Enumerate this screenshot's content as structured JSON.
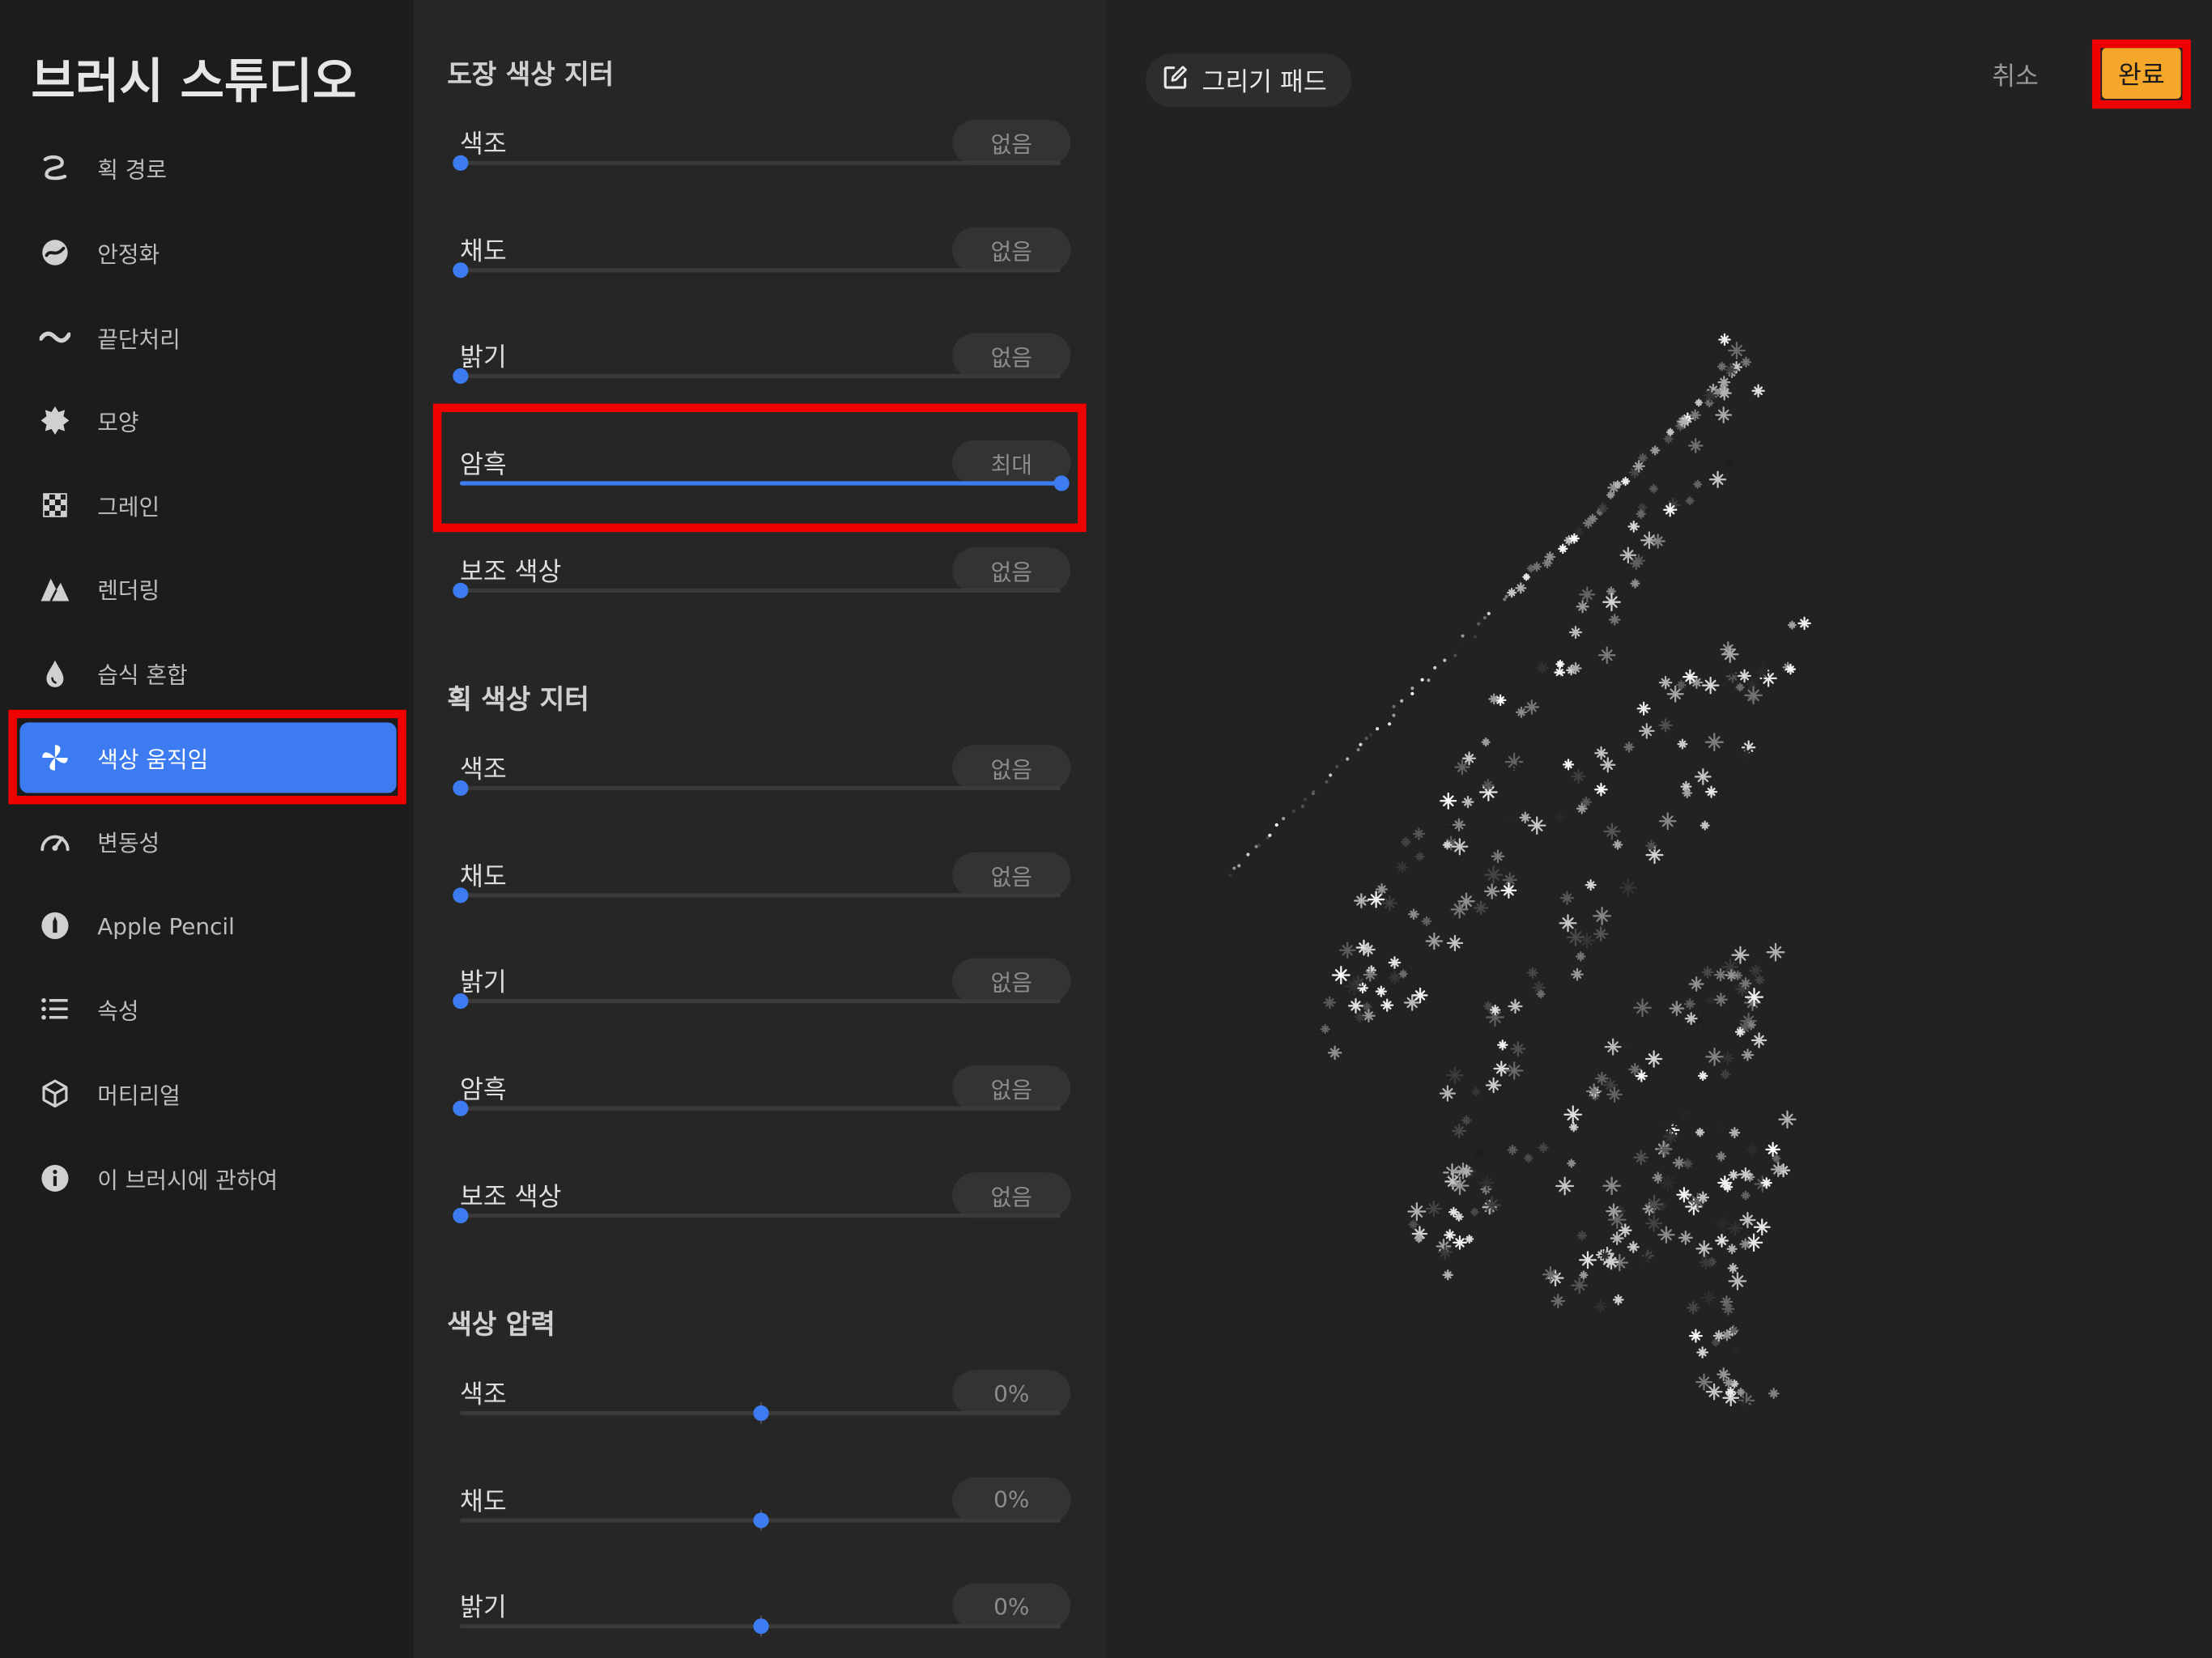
{
  "app_title": "브러시 스튜디오",
  "sidebar": {
    "items": [
      {
        "label": "획 경로",
        "icon": "stroke-path-icon"
      },
      {
        "label": "안정화",
        "icon": "stabilization-icon"
      },
      {
        "label": "끝단처리",
        "icon": "taper-icon"
      },
      {
        "label": "모양",
        "icon": "shape-icon"
      },
      {
        "label": "그레인",
        "icon": "grain-icon"
      },
      {
        "label": "렌더링",
        "icon": "rendering-icon"
      },
      {
        "label": "습식 혼합",
        "icon": "wet-mix-icon"
      },
      {
        "label": "색상 움직임",
        "icon": "color-dynamics-icon",
        "active": true
      },
      {
        "label": "변동성",
        "icon": "dynamics-icon"
      },
      {
        "label": "Apple Pencil",
        "icon": "apple-pencil-icon"
      },
      {
        "label": "속성",
        "icon": "properties-icon"
      },
      {
        "label": "머티리얼",
        "icon": "materials-icon"
      },
      {
        "label": "이 브러시에 관하여",
        "icon": "info-icon"
      }
    ]
  },
  "panel": {
    "stamp_jitter": {
      "title": "도장 색상 지터",
      "rows": [
        {
          "label": "색조",
          "value": "없음",
          "level": 0
        },
        {
          "label": "채도",
          "value": "없음",
          "level": 0
        },
        {
          "label": "밝기",
          "value": "없음",
          "level": 0
        },
        {
          "label": "암흑",
          "value": "최대",
          "level": 1
        },
        {
          "label": "보조 색상",
          "value": "없음",
          "level": 0
        }
      ]
    },
    "stroke_jitter": {
      "title": "획 색상 지터",
      "rows": [
        {
          "label": "색조",
          "value": "없음",
          "level": 0
        },
        {
          "label": "채도",
          "value": "없음",
          "level": 0
        },
        {
          "label": "밝기",
          "value": "없음",
          "level": 0
        },
        {
          "label": "암흑",
          "value": "없음",
          "level": 0
        },
        {
          "label": "보조 색상",
          "value": "없음",
          "level": 0
        }
      ]
    },
    "color_pressure": {
      "title": "색상 압력",
      "rows": [
        {
          "label": "색조",
          "value": "0%",
          "level": 0.5
        },
        {
          "label": "채도",
          "value": "0%",
          "level": 0.5
        },
        {
          "label": "밝기",
          "value": "0%",
          "level": 0.5
        }
      ]
    }
  },
  "canvas": {
    "pad_label": "그리기 패드",
    "cancel_label": "취소",
    "done_label": "완료"
  },
  "colors": {
    "accent": "#3d7bf0",
    "done": "#f4a72a",
    "highlight": "#f00000"
  }
}
